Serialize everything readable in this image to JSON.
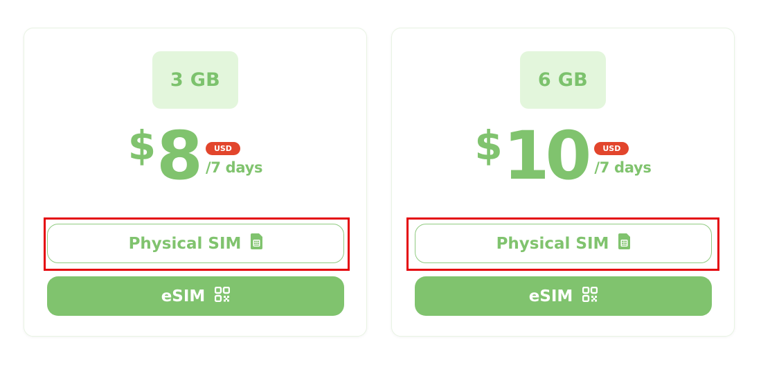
{
  "plans": [
    {
      "data_amount": "3 GB",
      "currency_symbol": "$",
      "price": "8",
      "currency_code": "USD",
      "period": "/7 days",
      "physical_button_label": "Physical SIM",
      "esim_button_label": "eSIM",
      "physical_highlighted": true
    },
    {
      "data_amount": "6 GB",
      "currency_symbol": "$",
      "price": "10",
      "currency_code": "USD",
      "period": "/7 days",
      "physical_button_label": "Physical SIM",
      "esim_button_label": "eSIM",
      "physical_highlighted": true
    }
  ],
  "icons": {
    "physical": "sim-card-icon",
    "esim": "qr-code-icon"
  },
  "colors": {
    "accent_green": "#80c36e",
    "badge_bg": "#e3f6dc",
    "usd_badge": "#e2452c",
    "highlight_border": "#e4050c"
  }
}
